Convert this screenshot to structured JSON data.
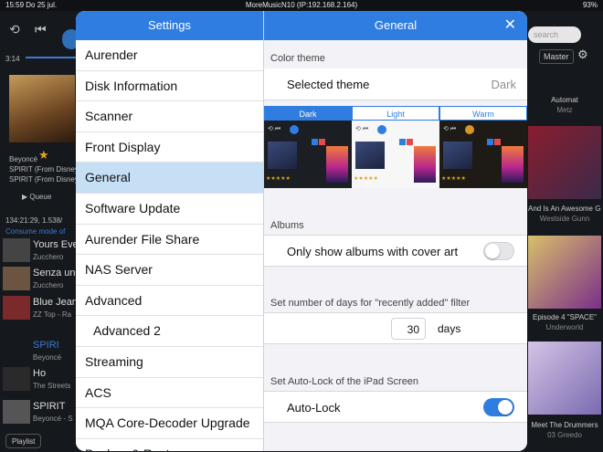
{
  "status": {
    "time": "15:59",
    "date": "Do 25 jul.",
    "title": "MoreMusicN10 (IP:192.168.2.164)",
    "battery": "93%"
  },
  "background": {
    "timecode": "3:14",
    "artist": "Beyoncé",
    "track_line1": "SPIRIT (From Disney",
    "track_line2": "SPIRIT (From Disney",
    "queue_label": "Queue",
    "info": "134:21:29, 1.538/",
    "consume": "Consume mode of",
    "list": [
      {
        "title": "Yours Ever",
        "sub": "Zucchero"
      },
      {
        "title": "Senza una",
        "sub": "Zucchero"
      },
      {
        "title": "Blue Jean",
        "sub": "ZZ Top - Ra"
      },
      {
        "title": "SPIRI",
        "sub": "Beyoncé"
      },
      {
        "title": "Ho",
        "sub": "The Streets"
      },
      {
        "title": "SPIRIT",
        "sub": "Beyoncé - S"
      }
    ],
    "playlist_btn": "Playlist",
    "search_placeholder": "search",
    "master_label": "Master",
    "right_tiles": [
      {
        "title": "Automat",
        "sub": "Metz"
      },
      {
        "title": "And Is An Awesome God",
        "sub": "Westside Gunn"
      },
      {
        "title": "Episode 4 \"SPACE\"",
        "sub": "Underworld"
      },
      {
        "title": "Meet The Drummers",
        "sub": "03 Greedo"
      }
    ]
  },
  "settings": {
    "title": "Settings",
    "items": [
      "Aurender",
      "Disk Information",
      "Scanner",
      "Front Display",
      "General",
      "Software Update",
      "Aurender File Share",
      "NAS Server",
      "Advanced",
      "Advanced 2",
      "Streaming",
      "ACS",
      "MQA Core-Decoder Upgrade",
      "Backup & Restore"
    ],
    "active": "General"
  },
  "general": {
    "title": "General",
    "color_theme_header": "Color theme",
    "selected_theme_label": "Selected theme",
    "selected_theme_value": "Dark",
    "themes": [
      "Dark",
      "Light",
      "Warm"
    ],
    "albums_header": "Albums",
    "albums_toggle_label": "Only show albums with cover art",
    "albums_toggle_on": false,
    "recent_header": "Set number of days for \"recently added\" filter",
    "recent_days": "30",
    "recent_unit": "days",
    "autolock_header": "Set Auto-Lock of the iPad Screen",
    "autolock_label": "Auto-Lock",
    "autolock_on": true
  },
  "colors": {
    "accent": "#2f7de0",
    "selected_row": "#c7dff5",
    "star": "#e0a31a"
  }
}
